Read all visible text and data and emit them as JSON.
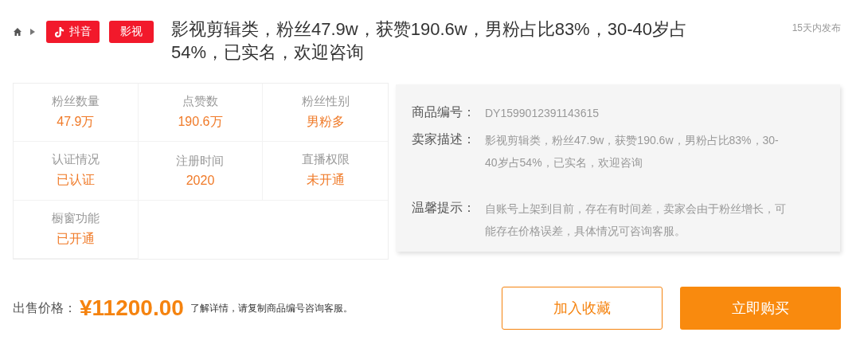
{
  "breadcrumb": {
    "tags": [
      {
        "kind": "platform",
        "label": "抖音"
      },
      {
        "kind": "category",
        "label": "影视"
      }
    ]
  },
  "title": "影视剪辑类，粉丝47.9w，获赞190.6w，男粉占比83%，30-40岁占54%，已实名，欢迎咨询",
  "posted": "15天内发布",
  "stats": [
    {
      "label": "粉丝数量",
      "value": "47.9万"
    },
    {
      "label": "点赞数",
      "value": "190.6万"
    },
    {
      "label": "粉丝性别",
      "value": "男粉多"
    },
    {
      "label": "认证情况",
      "value": "已认证"
    },
    {
      "label": "注册时间",
      "value": "2020"
    },
    {
      "label": "直播权限",
      "value": "未开通"
    },
    {
      "label": "橱窗功能",
      "value": "已开通"
    }
  ],
  "details": [
    {
      "label": "商品编号：",
      "value": "DY1599012391143615"
    },
    {
      "label": "卖家描述：",
      "value": "影视剪辑类，粉丝47.9w，获赞190.6w，男粉占比83%，30-40岁占54%，已实名，欢迎咨询"
    },
    {
      "label": "温馨提示：",
      "value": "自账号上架到目前，存在有时间差，卖家会由于粉丝增长，可能存在价格误差，具体情况可咨询客服。"
    }
  ],
  "price": {
    "label": "出售价格：",
    "amount": "¥11200.00",
    "note": "了解详情，请复制商品编号咨询客服。"
  },
  "buttons": [
    {
      "kind": "secondary",
      "label": "加入收藏"
    },
    {
      "kind": "primary",
      "label": "立即购买"
    }
  ]
}
